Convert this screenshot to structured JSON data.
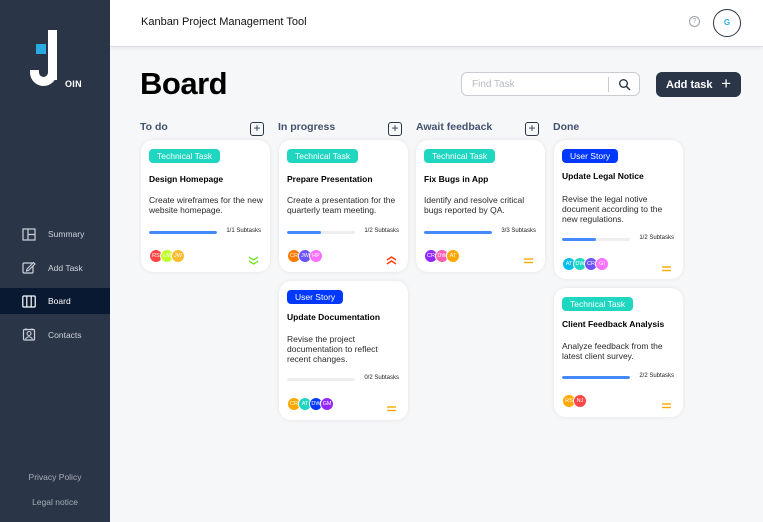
{
  "app": {
    "title": "Kanban Project Management Tool",
    "user_initial": "G",
    "help_glyph": "?"
  },
  "logo": {
    "letter": "J",
    "suffix": "OIN"
  },
  "nav": [
    {
      "label": "Summary",
      "icon": "summary-icon"
    },
    {
      "label": "Add Task",
      "icon": "edit-icon"
    },
    {
      "label": "Board",
      "icon": "board-icon",
      "active": true
    },
    {
      "label": "Contacts",
      "icon": "contacts-icon"
    }
  ],
  "footer": {
    "privacy": "Privacy Policy",
    "legal": "Legal notice"
  },
  "board": {
    "title": "Board",
    "search_placeholder": "Find Task",
    "add_task_label": "Add task",
    "add_task_plus": "+",
    "column_add_glyph": "+"
  },
  "columns": [
    {
      "title": "To do"
    },
    {
      "title": "In progress"
    },
    {
      "title": "Await feedback"
    },
    {
      "title": "Done"
    }
  ],
  "cards": [
    {
      "category": "Technical Task",
      "title": "Design Homepage",
      "description": "Create wireframes for the new website homepage.",
      "progress": 1.0,
      "subtasks": "1/1 Subtasks",
      "priority": "low",
      "assignees": [
        {
          "initials": "RS",
          "color": "#ff4646"
        },
        {
          "initials": "LM",
          "color": "#c3ff2b"
        },
        {
          "initials": "JW",
          "color": "#ffbb2b"
        }
      ]
    },
    {
      "category": "Technical Task",
      "title": "Prepare Presentation",
      "description": "Create a presentation for the quarterly team meeting.",
      "progress": 0.5,
      "subtasks": "1/2 Subtasks",
      "priority": "urgent",
      "assignees": [
        {
          "initials": "CR",
          "color": "#ff7a00"
        },
        {
          "initials": "JW",
          "color": "#6e52ff"
        },
        {
          "initials": "HP",
          "color": "#fc71ff"
        }
      ]
    },
    {
      "category": "User Story",
      "title": "Update Documentation",
      "description": "Revise the project documentation to reflect recent changes.",
      "progress": 0,
      "subtasks": "0/2 Subtasks",
      "priority": "medium",
      "assignees": [
        {
          "initials": "CR",
          "color": "#ffa800"
        },
        {
          "initials": "AT",
          "color": "#1fd7c1"
        },
        {
          "initials": "DW",
          "color": "#0038ff"
        },
        {
          "initials": "GM",
          "color": "#9327ff"
        }
      ]
    },
    {
      "category": "Technical Task",
      "title": "Fix Bugs in App",
      "description": "Identify and resolve critical bugs reported by QA.",
      "progress": 1.0,
      "subtasks": "3/3 Subtasks",
      "priority": "medium",
      "assignees": [
        {
          "initials": "CR",
          "color": "#9327ff"
        },
        {
          "initials": "DW",
          "color": "#ff5eb3"
        },
        {
          "initials": "AT",
          "color": "#ffa800"
        }
      ]
    },
    {
      "category": "User Story",
      "title": "Update Legal Notice",
      "description": "Revise the legal notive document according to the new regulations.",
      "progress": 0.5,
      "subtasks": "1/2 Subtasks",
      "priority": "medium",
      "assignees": [
        {
          "initials": "AT",
          "color": "#00bee8"
        },
        {
          "initials": "DW",
          "color": "#1fd7c1"
        },
        {
          "initials": "CR",
          "color": "#6e52ff"
        },
        {
          "initials": "GI",
          "color": "#fc71ff"
        }
      ]
    },
    {
      "category": "Technical Task",
      "title": "Client Feedback Analysis",
      "description": "Analyze feedback from the latest client survey.",
      "progress": 1.0,
      "subtasks": "2/2 Subtasks",
      "priority": "medium",
      "assignees": [
        {
          "initials": "RS",
          "color": "#ffa800"
        },
        {
          "initials": "NJ",
          "color": "#ff4646"
        }
      ]
    }
  ],
  "colors": {
    "sidebar": "#2a3647",
    "active_nav": "#091931",
    "technical_task": "#1fd7c1",
    "user_story": "#0038ff",
    "progress": "#4589ff",
    "prio_low": "#7ae229",
    "prio_medium": "#ffa800",
    "prio_urgent": "#ff3d00"
  }
}
